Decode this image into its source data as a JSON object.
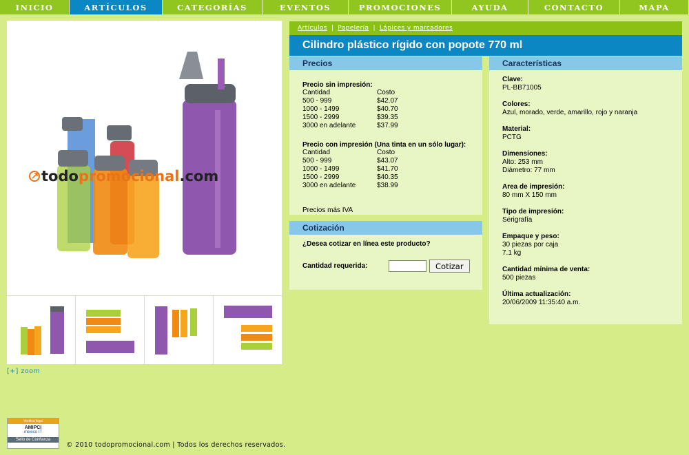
{
  "nav": {
    "items": [
      {
        "label": "Inicio",
        "active": false
      },
      {
        "label": "Artículos",
        "active": true
      },
      {
        "label": "Categorías",
        "active": false
      },
      {
        "label": "Eventos",
        "active": false
      },
      {
        "label": "Promociones",
        "active": false
      },
      {
        "label": "Ayuda",
        "active": false
      },
      {
        "label": "Contacto",
        "active": false
      },
      {
        "label": "Mapa",
        "active": false
      }
    ],
    "colors": {
      "bar": "#90c61f",
      "active": "#0b87c4"
    }
  },
  "breadcrumb": {
    "items": [
      "Artículos",
      "Papelería",
      "Lápices y marcadores"
    ],
    "separator": "|"
  },
  "product": {
    "title": "Cilindro plástico rígido con popote 770 ml",
    "image_watermark": "todopromocional.com",
    "zoom_label": "[+] zoom"
  },
  "precios": {
    "heading": "Precios",
    "sin_impresion": {
      "label": "Precio sin impresión:",
      "col_qty": "Cantidad",
      "col_cost": "Costo",
      "rows": [
        {
          "qty": "500 - 999",
          "cost": "$42.07"
        },
        {
          "qty": "1000 - 1499",
          "cost": "$40.70"
        },
        {
          "qty": "1500 - 2999",
          "cost": "$39.35"
        },
        {
          "qty": "3000 en adelante",
          "cost": "$37.99"
        }
      ]
    },
    "con_impresion": {
      "label": "Precio con impresión (Una tinta en un sólo lugar):",
      "col_qty": "Cantidad",
      "col_cost": "Costo",
      "rows": [
        {
          "qty": "500 - 999",
          "cost": "$43.07"
        },
        {
          "qty": "1000 - 1499",
          "cost": "$41.70"
        },
        {
          "qty": "1500 - 2999",
          "cost": "$40.35"
        },
        {
          "qty": "3000 en adelante",
          "cost": "$38.99"
        }
      ]
    },
    "note": "Precios más IVA"
  },
  "cotizacion": {
    "heading": "Cotización",
    "question": "¿Desea cotizar en línea este producto?",
    "qty_label": "Cantidad requerida:",
    "qty_value": "",
    "button": "Cotizar"
  },
  "caracteristicas": {
    "heading": "Características",
    "fields": [
      {
        "label": "Clave:",
        "lines": [
          "PL-BB71005"
        ]
      },
      {
        "label": "Colores:",
        "lines": [
          "Azul, morado, verde, amarillo, rojo y naranja"
        ]
      },
      {
        "label": "Material:",
        "lines": [
          "PCTG"
        ]
      },
      {
        "label": "Dimensiones:",
        "lines": [
          "Alto: 253 mm",
          "Diámetro: 77 mm"
        ]
      },
      {
        "label": "Area de impresión:",
        "lines": [
          "80 mm X 150 mm"
        ]
      },
      {
        "label": "Tipo de impresión:",
        "lines": [
          "Serigrafía"
        ]
      },
      {
        "label": "Empaque y peso:",
        "lines": [
          "30 piezas por caja",
          "7.1 kg"
        ]
      },
      {
        "label": "Cantidad mínima de venta:",
        "lines": [
          "500 piezas"
        ]
      },
      {
        "label": "Última actualización:",
        "lines": [
          "20/06/2009 11:35:40 a.m."
        ]
      }
    ]
  },
  "footer": {
    "seal": {
      "line1": "Verifica Aqui",
      "line2": "AMIPCI",
      "line3": "mexico IT",
      "line4": "Sello de Confianza"
    },
    "copyright": "© 2010 todopromocional.com  |  Todos los derechos reservados."
  },
  "icons": {
    "bottle": "bottle-icon",
    "arrow": "arrow-logo-icon"
  }
}
